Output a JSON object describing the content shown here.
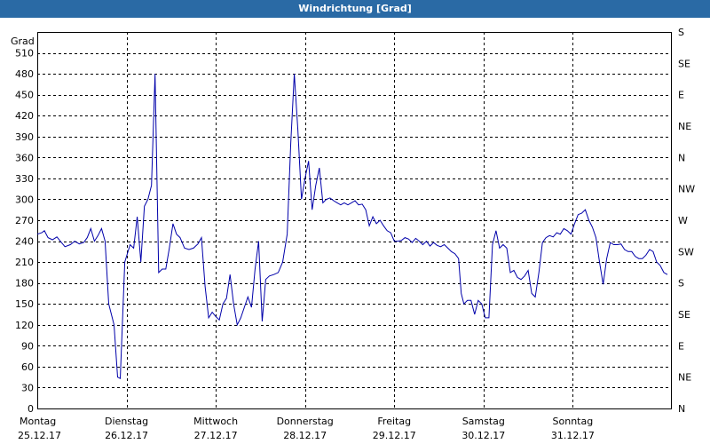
{
  "window": {
    "title": "Windrichtung [Grad]"
  },
  "chart_data": {
    "type": "line",
    "title": "Windrichtung [Grad]",
    "ylabel": "Grad",
    "ylim": [
      0,
      540
    ],
    "yticks": [
      0,
      30,
      60,
      90,
      120,
      150,
      180,
      210,
      240,
      270,
      300,
      330,
      360,
      390,
      420,
      450,
      480,
      510
    ],
    "right_axis_labels": [
      "N",
      "NE",
      "E",
      "SE",
      "S",
      "SW",
      "W",
      "NW",
      "N",
      "NE",
      "E",
      "SE",
      "S"
    ],
    "days": [
      {
        "name": "Montag",
        "date": "25.12.17"
      },
      {
        "name": "Dienstag",
        "date": "26.12.17"
      },
      {
        "name": "Mittwoch",
        "date": "27.12.17"
      },
      {
        "name": "Donnerstag",
        "date": "28.12.17"
      },
      {
        "name": "Freitag",
        "date": "29.12.17"
      },
      {
        "name": "Samstag",
        "date": "30.12.17"
      },
      {
        "name": "Sonntag",
        "date": "31.12.17"
      }
    ],
    "xlim_days": [
      0,
      7.1
    ],
    "grid": true,
    "series": [
      {
        "color": "#0000aa",
        "points": [
          [
            0.0,
            250
          ],
          [
            0.05,
            252
          ],
          [
            0.08,
            255
          ],
          [
            0.12,
            245
          ],
          [
            0.17,
            242
          ],
          [
            0.22,
            246
          ],
          [
            0.27,
            238
          ],
          [
            0.31,
            232
          ],
          [
            0.37,
            235
          ],
          [
            0.42,
            240
          ],
          [
            0.47,
            236
          ],
          [
            0.52,
            238
          ],
          [
            0.56,
            245
          ],
          [
            0.6,
            258
          ],
          [
            0.64,
            240
          ],
          [
            0.68,
            248
          ],
          [
            0.72,
            258
          ],
          [
            0.76,
            240
          ],
          [
            0.8,
            150
          ],
          [
            0.86,
            120
          ],
          [
            0.9,
            45
          ],
          [
            0.93,
            43
          ],
          [
            0.98,
            210
          ],
          [
            1.04,
            235
          ],
          [
            1.08,
            230
          ],
          [
            1.12,
            275
          ],
          [
            1.16,
            210
          ],
          [
            1.2,
            290
          ],
          [
            1.24,
            300
          ],
          [
            1.28,
            320
          ],
          [
            1.32,
            480
          ],
          [
            1.36,
            195
          ],
          [
            1.4,
            200
          ],
          [
            1.44,
            200
          ],
          [
            1.48,
            230
          ],
          [
            1.52,
            265
          ],
          [
            1.56,
            250
          ],
          [
            1.6,
            245
          ],
          [
            1.65,
            230
          ],
          [
            1.7,
            228
          ],
          [
            1.75,
            230
          ],
          [
            1.8,
            236
          ],
          [
            1.84,
            245
          ],
          [
            1.88,
            175
          ],
          [
            1.92,
            130
          ],
          [
            1.96,
            138
          ],
          [
            2.0,
            132
          ],
          [
            2.04,
            127
          ],
          [
            2.08,
            150
          ],
          [
            2.12,
            158
          ],
          [
            2.16,
            192
          ],
          [
            2.2,
            150
          ],
          [
            2.24,
            120
          ],
          [
            2.28,
            130
          ],
          [
            2.32,
            145
          ],
          [
            2.36,
            160
          ],
          [
            2.4,
            145
          ],
          [
            2.44,
            200
          ],
          [
            2.48,
            240
          ],
          [
            2.52,
            125
          ],
          [
            2.56,
            185
          ],
          [
            2.6,
            190
          ],
          [
            2.65,
            192
          ],
          [
            2.7,
            195
          ],
          [
            2.75,
            210
          ],
          [
            2.8,
            250
          ],
          [
            2.84,
            380
          ],
          [
            2.88,
            480
          ],
          [
            2.92,
            400
          ],
          [
            2.96,
            300
          ],
          [
            3.0,
            330
          ],
          [
            3.04,
            355
          ],
          [
            3.08,
            285
          ],
          [
            3.12,
            320
          ],
          [
            3.16,
            345
          ],
          [
            3.2,
            295
          ],
          [
            3.24,
            300
          ],
          [
            3.28,
            302
          ],
          [
            3.32,
            298
          ],
          [
            3.36,
            295
          ],
          [
            3.4,
            292
          ],
          [
            3.44,
            295
          ],
          [
            3.48,
            292
          ],
          [
            3.52,
            295
          ],
          [
            3.56,
            298
          ],
          [
            3.6,
            292
          ],
          [
            3.64,
            293
          ],
          [
            3.68,
            285
          ],
          [
            3.72,
            262
          ],
          [
            3.76,
            275
          ],
          [
            3.8,
            265
          ],
          [
            3.84,
            270
          ],
          [
            3.88,
            262
          ],
          [
            3.92,
            255
          ],
          [
            3.96,
            252
          ],
          [
            4.0,
            240
          ],
          [
            4.04,
            240
          ],
          [
            4.08,
            241
          ],
          [
            4.12,
            245
          ],
          [
            4.16,
            243
          ],
          [
            4.2,
            238
          ],
          [
            4.24,
            244
          ],
          [
            4.28,
            240
          ],
          [
            4.32,
            235
          ],
          [
            4.36,
            240
          ],
          [
            4.4,
            233
          ],
          [
            4.44,
            238
          ],
          [
            4.48,
            234
          ],
          [
            4.52,
            232
          ],
          [
            4.56,
            235
          ],
          [
            4.6,
            230
          ],
          [
            4.64,
            225
          ],
          [
            4.68,
            222
          ],
          [
            4.72,
            215
          ],
          [
            4.75,
            165
          ],
          [
            4.78,
            150
          ],
          [
            4.82,
            155
          ],
          [
            4.86,
            155
          ],
          [
            4.9,
            135
          ],
          [
            4.94,
            155
          ],
          [
            4.98,
            150
          ],
          [
            5.02,
            130
          ],
          [
            5.06,
            130
          ],
          [
            5.1,
            235
          ],
          [
            5.14,
            255
          ],
          [
            5.18,
            230
          ],
          [
            5.22,
            235
          ],
          [
            5.26,
            230
          ],
          [
            5.3,
            195
          ],
          [
            5.34,
            198
          ],
          [
            5.38,
            188
          ],
          [
            5.42,
            185
          ],
          [
            5.46,
            190
          ],
          [
            5.5,
            198
          ],
          [
            5.54,
            165
          ],
          [
            5.58,
            160
          ],
          [
            5.62,
            195
          ],
          [
            5.66,
            238
          ],
          [
            5.7,
            245
          ],
          [
            5.74,
            248
          ],
          [
            5.78,
            246
          ],
          [
            5.82,
            252
          ],
          [
            5.86,
            250
          ],
          [
            5.9,
            258
          ],
          [
            5.94,
            255
          ],
          [
            5.98,
            250
          ],
          [
            6.02,
            265
          ],
          [
            6.06,
            278
          ],
          [
            6.1,
            280
          ],
          [
            6.14,
            285
          ],
          [
            6.18,
            270
          ],
          [
            6.22,
            260
          ],
          [
            6.26,
            245
          ],
          [
            6.3,
            210
          ],
          [
            6.34,
            178
          ],
          [
            6.38,
            215
          ],
          [
            6.42,
            238
          ],
          [
            6.46,
            235
          ],
          [
            6.5,
            235
          ],
          [
            6.54,
            236
          ],
          [
            6.58,
            228
          ],
          [
            6.62,
            225
          ],
          [
            6.66,
            225
          ],
          [
            6.7,
            218
          ],
          [
            6.74,
            215
          ],
          [
            6.78,
            215
          ],
          [
            6.82,
            220
          ],
          [
            6.86,
            228
          ],
          [
            6.9,
            225
          ],
          [
            6.94,
            210
          ],
          [
            6.98,
            205
          ],
          [
            7.02,
            195
          ],
          [
            7.06,
            192
          ]
        ]
      }
    ]
  }
}
